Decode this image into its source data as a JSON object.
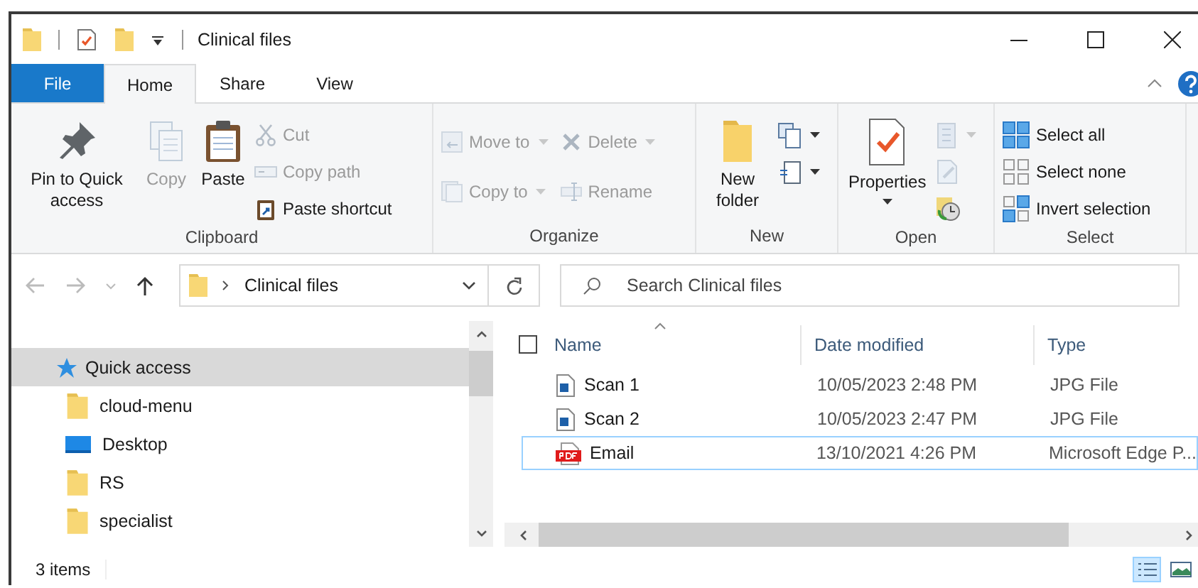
{
  "window": {
    "title": "Clinical files"
  },
  "tabs": [
    {
      "label": "File",
      "kind": "file",
      "selected": false
    },
    {
      "label": "Home",
      "kind": "tab",
      "selected": true
    },
    {
      "label": "Share",
      "kind": "tab",
      "selected": false
    },
    {
      "label": "View",
      "kind": "tab",
      "selected": false
    }
  ],
  "ribbon": {
    "groups": [
      {
        "label": "Clipboard",
        "items": [
          {
            "kind": "large",
            "label": "Pin to Quick access",
            "disabled": false
          },
          {
            "kind": "large",
            "label": "Copy",
            "disabled": true
          },
          {
            "kind": "large",
            "label": "Paste",
            "disabled": false
          },
          {
            "kind": "stack",
            "items": [
              {
                "label": "Cut",
                "disabled": true
              },
              {
                "label": "Copy path",
                "disabled": true
              },
              {
                "label": "Paste shortcut",
                "disabled": false
              }
            ]
          }
        ]
      },
      {
        "label": "Organize",
        "items": [
          {
            "kind": "stack",
            "items": [
              {
                "label": "Move to",
                "disabled": true,
                "dropdown": true
              },
              {
                "label": "Copy to",
                "disabled": true,
                "dropdown": true
              }
            ]
          },
          {
            "kind": "stack",
            "items": [
              {
                "label": "Delete",
                "disabled": true,
                "dropdown": true
              },
              {
                "label": "Rename",
                "disabled": true
              }
            ]
          }
        ]
      },
      {
        "label": "New",
        "items": [
          {
            "kind": "large",
            "label": "New folder",
            "disabled": false
          },
          {
            "kind": "stack",
            "items": [
              {
                "disabled": false,
                "dropdown": true
              },
              {
                "disabled": false,
                "dropdown": true
              }
            ]
          }
        ]
      },
      {
        "label": "Open",
        "items": [
          {
            "kind": "large",
            "label": "Properties",
            "disabled": false,
            "dropdown": true
          },
          {
            "kind": "stack",
            "items": [
              {
                "disabled": true,
                "dropdown": true
              },
              {
                "disabled": true
              },
              {
                "disabled": false
              }
            ]
          }
        ]
      },
      {
        "label": "Select",
        "items": [
          {
            "kind": "stack",
            "items": [
              {
                "label": "Select all",
                "disabled": false
              },
              {
                "label": "Select none",
                "disabled": false
              },
              {
                "label": "Invert selection",
                "disabled": false
              }
            ]
          }
        ]
      }
    ]
  },
  "address": {
    "path": [
      "Clinical files"
    ]
  },
  "search": {
    "placeholder": "Search Clinical files"
  },
  "sidebar": {
    "items": [
      {
        "label": "Quick access",
        "kind": "quick-access",
        "selected": true,
        "children": [
          {
            "label": "cloud-menu",
            "kind": "folder",
            "selected": false
          },
          {
            "label": "Desktop",
            "kind": "desktop",
            "selected": false
          },
          {
            "label": "RS",
            "kind": "folder",
            "selected": false
          },
          {
            "label": "specialist",
            "kind": "folder",
            "selected": false
          }
        ]
      }
    ]
  },
  "file_list": {
    "select_all_checked": false,
    "columns": [
      {
        "label": "Name",
        "sorted": true
      },
      {
        "label": "Date modified",
        "sorted": false
      },
      {
        "label": "Type",
        "sorted": false
      }
    ],
    "rows": [
      {
        "name": "Scan 1",
        "date": "10/05/2023 2:48 PM",
        "type": "JPG File",
        "kind": "image",
        "focused": false
      },
      {
        "name": "Scan 2",
        "date": "10/05/2023 2:47 PM",
        "type": "JPG File",
        "kind": "image",
        "focused": false
      },
      {
        "name": "Email",
        "date": "13/10/2021 4:26 PM",
        "type": "Microsoft Edge P...",
        "kind": "pdf",
        "focused": true
      }
    ]
  },
  "status_bar": {
    "item_count": "3 items"
  }
}
